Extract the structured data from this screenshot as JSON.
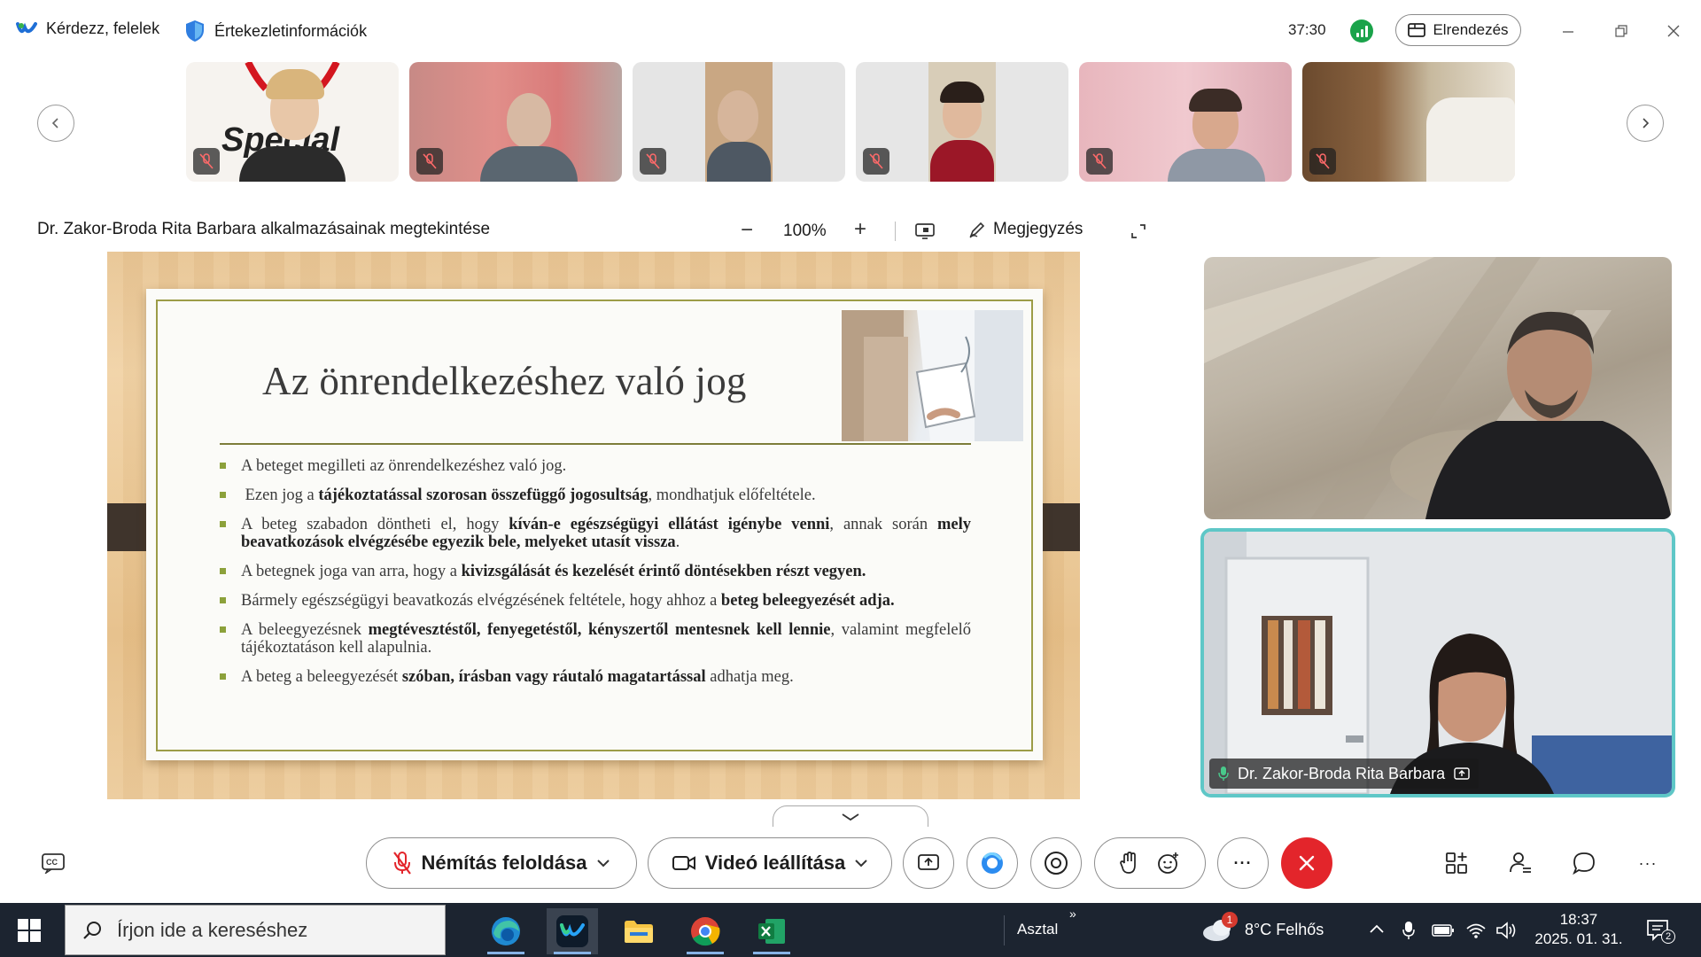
{
  "titlebar": {
    "qa_label": "Kérdezz, felelek",
    "meeting_info_label": "Értekezletinformációk",
    "timer": "37:30",
    "layout_label": "Elrendezés"
  },
  "share": {
    "title": "Dr. Zakor-Broda Rita Barbara alkalmazásainak megtekintése",
    "zoom": "100%",
    "annotate_label": "Megjegyzés"
  },
  "slide": {
    "title": "Az önrendelkezéshez való jog",
    "bullets": [
      {
        "before": "A beteget megilleti az önrendelkezéshez való jog.",
        "bold": "",
        "after": ""
      },
      {
        "before": "Ezen jog a ",
        "bold": "tájékoztatással szorosan összefüggő jogosultság",
        "after": ", mondhatjuk előfeltétele."
      },
      {
        "before": "A beteg szabadon döntheti el, hogy ",
        "bold": "kíván-e egészségügyi ellátást igénybe venni",
        "after": ", annak során ",
        "bold2": "mely beavatkozások elvégzésébe egyezik bele, melyeket utasít vissza",
        "after2": "."
      },
      {
        "before": "A betegnek joga van arra, hogy a ",
        "bold": "kivizsgálását és kezelését érintő döntésekben részt vegyen.",
        "after": ""
      },
      {
        "before": "Bármely egészségügyi beavatkozás elvégzésének feltétele, hogy ahhoz a ",
        "bold": "beteg beleegyezését adja.",
        "after": ""
      },
      {
        "before": "A beleegyezésnek ",
        "bold": "megtévesztéstől, fenyegetéstől, kényszertől mentesnek kell lennie",
        "after": ", valamint megfelelő tájékoztatáson kell alapulnia."
      },
      {
        "before": "A beteg a beleegyezését ",
        "bold": "szóban, írásban vagy ráutaló magatartással",
        "after": " adhatja meg."
      }
    ]
  },
  "presenter": {
    "name": "Dr. Zakor-Broda Rita Barbara"
  },
  "controls": {
    "unmute_label": "Némítás feloldása",
    "stop_video_label": "Videó leállítása",
    "more_label": "···"
  },
  "taskbar": {
    "search_placeholder": "Írjon ide a kereséshez",
    "desktop_label": "Asztal",
    "weather": "8°C  Felhős",
    "time": "18:37",
    "date": "2025. 01. 31.",
    "weather_badge": "1",
    "notification_count": "2"
  },
  "colors": {
    "accent_teal": "#5fc7c7",
    "leave_red": "#e3252b",
    "slide_bullet": "#8ca13b",
    "taskbar_bg": "#1c2430"
  }
}
